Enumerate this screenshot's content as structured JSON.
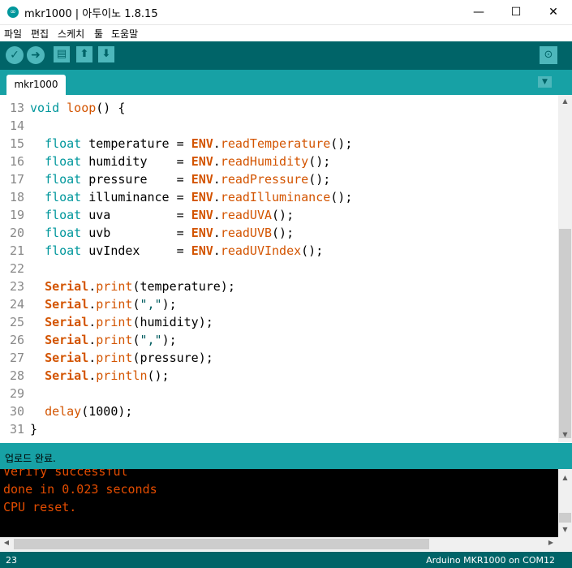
{
  "window": {
    "title": "mkr1000 | 아두이노 1.8.15",
    "minimize": "—",
    "maximize": "☐",
    "close": "✕"
  },
  "menu": [
    "파일",
    "편집",
    "스케치",
    "툴",
    "도움말"
  ],
  "toolbar": {
    "verify_icon": "check-icon",
    "upload_icon": "arrow-right-icon",
    "new_icon": "document-icon",
    "open_icon": "arrow-up-icon",
    "save_icon": "arrow-down-icon",
    "serial_icon": "magnifier-icon"
  },
  "tab": {
    "label": "mkr1000"
  },
  "editor": {
    "lines": [
      {
        "n": "13",
        "text": "void loop() {"
      },
      {
        "n": "14",
        "text": ""
      },
      {
        "n": "15",
        "text": "  float temperature = ENV.readTemperature();"
      },
      {
        "n": "16",
        "text": "  float humidity    = ENV.readHumidity();"
      },
      {
        "n": "17",
        "text": "  float pressure    = ENV.readPressure();"
      },
      {
        "n": "18",
        "text": "  float illuminance = ENV.readIlluminance();"
      },
      {
        "n": "19",
        "text": "  float uva         = ENV.readUVA();"
      },
      {
        "n": "20",
        "text": "  float uvb         = ENV.readUVB();"
      },
      {
        "n": "21",
        "text": "  float uvIndex     = ENV.readUVIndex();"
      },
      {
        "n": "22",
        "text": ""
      },
      {
        "n": "23",
        "text": "  Serial.print(temperature);"
      },
      {
        "n": "24",
        "text": "  Serial.print(\",\");"
      },
      {
        "n": "25",
        "text": "  Serial.print(humidity);"
      },
      {
        "n": "26",
        "text": "  Serial.print(\",\");"
      },
      {
        "n": "27",
        "text": "  Serial.print(pressure);"
      },
      {
        "n": "28",
        "text": "  Serial.println();"
      },
      {
        "n": "29",
        "text": ""
      },
      {
        "n": "30",
        "text": "  delay(1000);"
      },
      {
        "n": "31",
        "text": "}"
      }
    ]
  },
  "status": {
    "message": "업로드 완료."
  },
  "console": {
    "lines": [
      "Verify successful",
      "done in 0.023 seconds",
      "CPU reset."
    ]
  },
  "bottom": {
    "line_number": "23",
    "board": "Arduino MKR1000 on COM12"
  },
  "colors": {
    "toolbar": "#006468",
    "tabbar": "#17a1a5",
    "keyword": "#00979c",
    "object": "#d35400",
    "console_text": "#e34c00"
  }
}
